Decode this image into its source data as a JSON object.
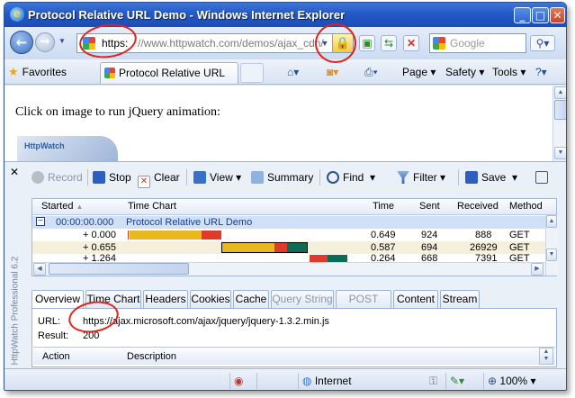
{
  "window": {
    "title": "Protocol Relative URL Demo - Windows Internet Explorer"
  },
  "address": {
    "protocol": "https:",
    "rest": "//www.httpwatch.com/demos/ajax_cdn/",
    "lock_icon": "lock-icon",
    "search_placeholder": "Google"
  },
  "commandbar": {
    "favorites": "Favorites",
    "tab_title": "Protocol Relative URL Demo",
    "page": "Page",
    "safety": "Safety",
    "tools": "Tools"
  },
  "content": {
    "message": "Click on image to run jQuery animation:",
    "thumb_text": "HttpWatch"
  },
  "httpwatch": {
    "vertical_label": "HttpWatch Professional 6.2",
    "toolbar": {
      "record": "Record",
      "stop": "Stop",
      "clear": "Clear",
      "view": "View",
      "summary": "Summary",
      "find": "Find",
      "filter": "Filter",
      "save": "Save"
    },
    "columns": {
      "started": "Started",
      "timechart": "Time Chart",
      "time": "Time",
      "sent": "Sent",
      "received": "Received",
      "method": "Method"
    },
    "page_row": {
      "started": "00:00:00.000",
      "title": "Protocol Relative URL Demo"
    },
    "rows": [
      {
        "started": "+ 0.000",
        "time": "0.649",
        "sent": "924",
        "received": "888",
        "method": "GET"
      },
      {
        "started": "+ 0.655",
        "time": "0.587",
        "sent": "694",
        "received": "26929",
        "method": "GET"
      },
      {
        "started": "+ 1.264",
        "time": "0.264",
        "sent": "668",
        "received": "7391",
        "method": "GET"
      }
    ],
    "detail_tabs": [
      "Overview",
      "Time Chart",
      "Headers",
      "Cookies",
      "Cache",
      "Query String",
      "POST Data",
      "Content",
      "Stream"
    ],
    "detail": {
      "url_label": "URL:",
      "url": "https://ajax.microsoft.com/ajax/jquery/jquery-1.3.2.min.js",
      "result_label": "Result:",
      "result": "200",
      "col_action": "Action",
      "col_description": "Description"
    }
  },
  "status": {
    "zone": "Internet",
    "zoom": "100%"
  },
  "colors": {
    "accent": "#2358c6",
    "annotation": "#e0231b",
    "bar_yellow": "#e8b820",
    "bar_red": "#e03b2a",
    "bar_teal": "#0e6b5a"
  }
}
